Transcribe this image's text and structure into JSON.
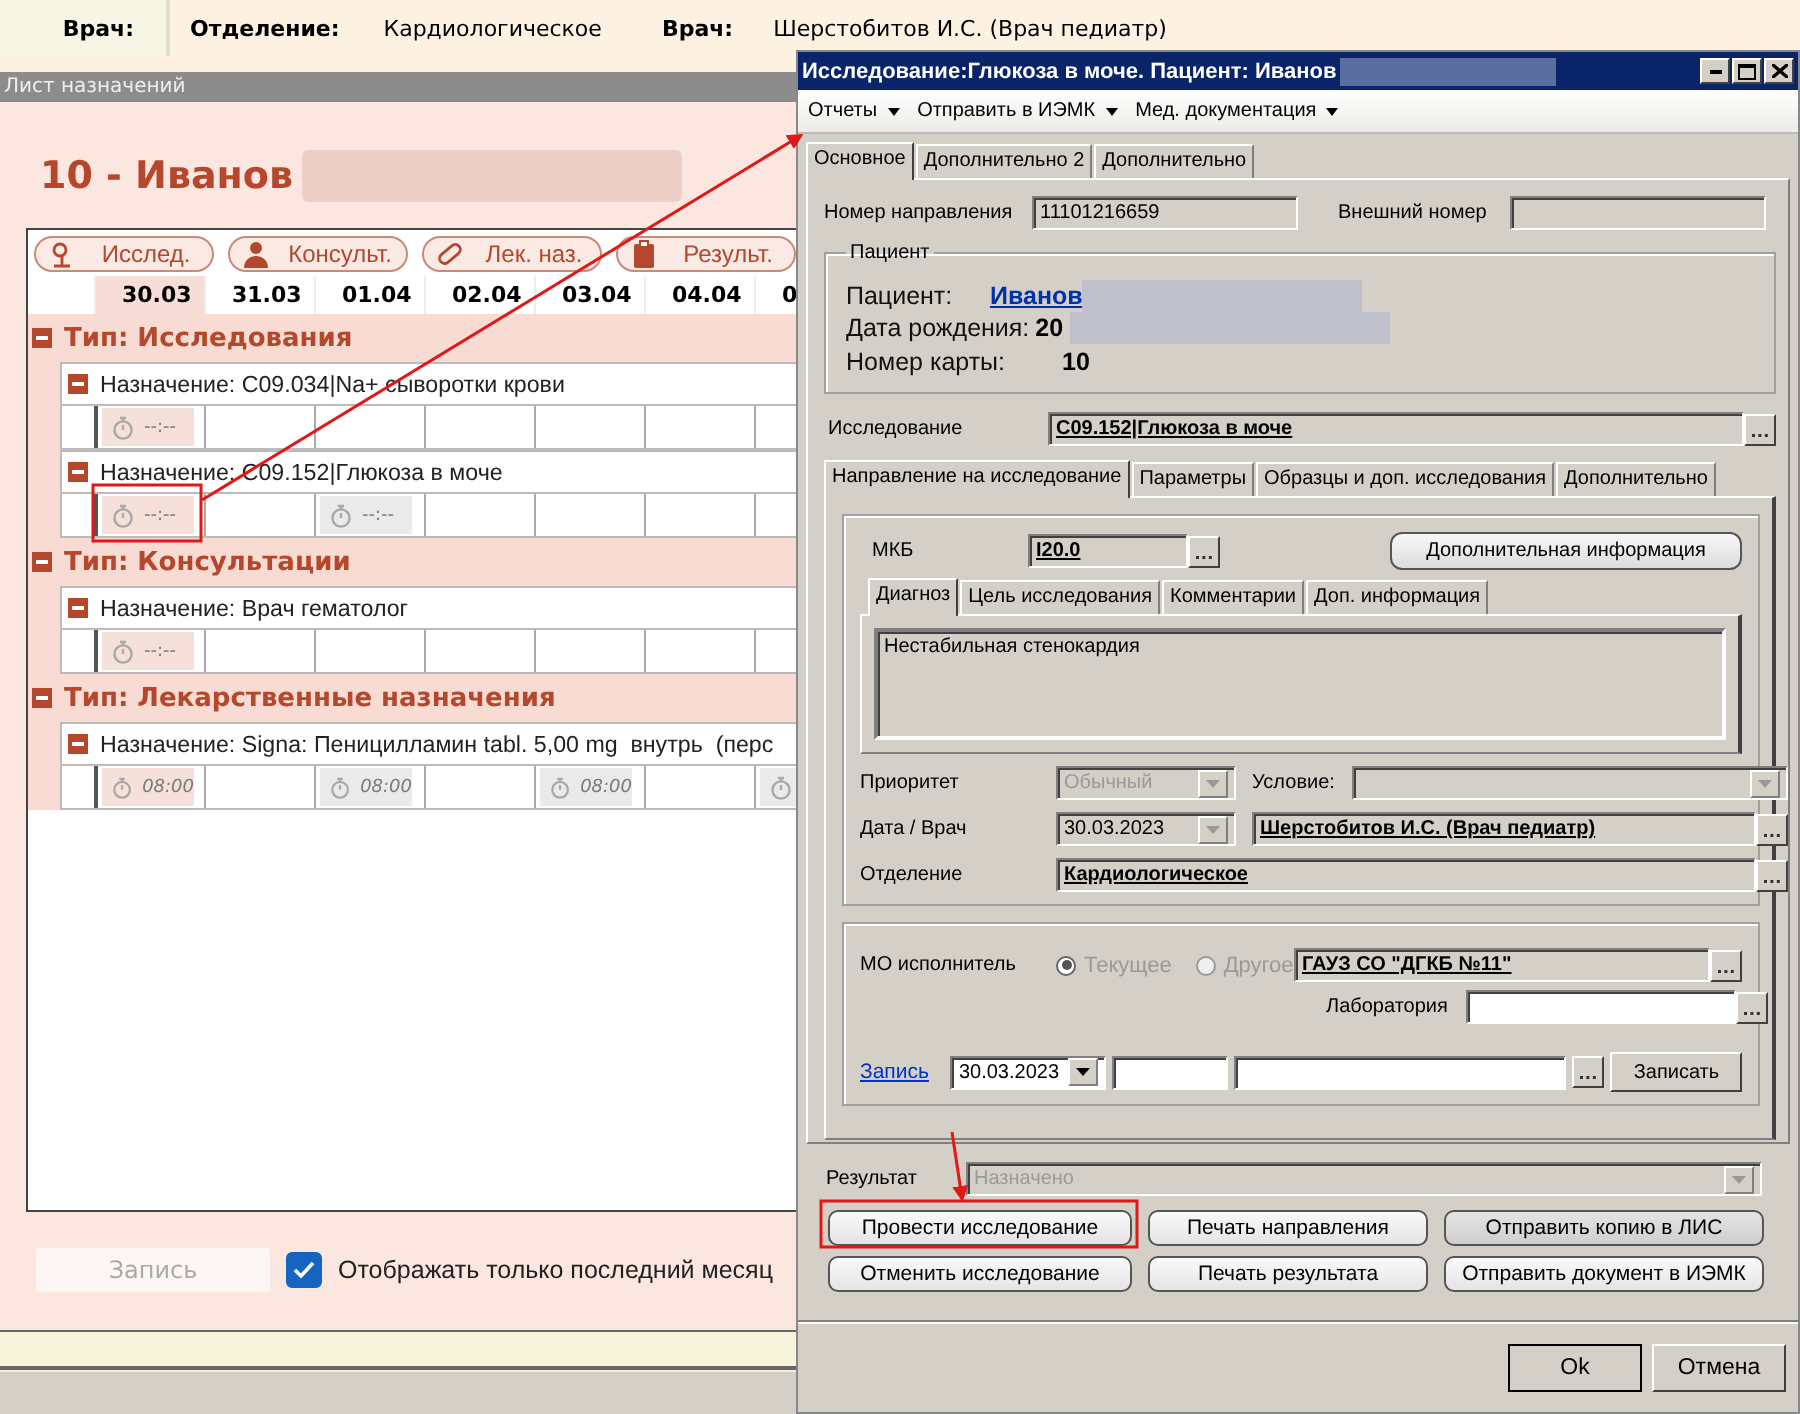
{
  "header": {
    "left_label": "Врач:",
    "department_label": "Отделение:",
    "department": "Кардиологическое",
    "doctor_label": "Врач:",
    "doctor": "Шерстобитов И.С. (Врач педиатр)"
  },
  "schedule": {
    "title": "Лист назначений",
    "patient": "10 - Иванов",
    "toolbar": [
      "Исслед.",
      "Консульт.",
      "Лек. наз.",
      "Результ."
    ],
    "dates": [
      {
        "label": "30.03",
        "selected": true
      },
      {
        "label": "31.03",
        "selected": false
      },
      {
        "label": "01.04",
        "selected": false
      },
      {
        "label": "02.04",
        "selected": false
      },
      {
        "label": "03.04",
        "selected": false
      },
      {
        "label": "04.04",
        "selected": false
      },
      {
        "label": "0",
        "selected": false
      }
    ],
    "groups": [
      {
        "title": "Тип: Исследования",
        "expanded": true,
        "items": [
          {
            "title": "Назначение: C09.034|Na+ сыворотки крови",
            "expanded": true,
            "cells": [
              {
                "kind": "slot",
                "time": "--:--"
              },
              {
                "kind": "blank"
              },
              {
                "kind": "blank"
              },
              {
                "kind": "blank"
              },
              {
                "kind": "blank"
              },
              {
                "kind": "blank"
              },
              {
                "kind": "blank"
              }
            ]
          },
          {
            "title": "Назначение: C09.152|Глюкоза в моче",
            "expanded": true,
            "cells": [
              {
                "kind": "slot",
                "time": "--:--"
              },
              {
                "kind": "blank"
              },
              {
                "kind": "slot",
                "time": "--:--"
              },
              {
                "kind": "blank"
              },
              {
                "kind": "blank"
              },
              {
                "kind": "blank"
              },
              {
                "kind": "blank"
              }
            ]
          }
        ]
      },
      {
        "title": "Тип: Консультации",
        "expanded": true,
        "items": [
          {
            "title": "Назначение: Врач гематолог",
            "expanded": true,
            "cells": [
              {
                "kind": "slot",
                "time": "--:--"
              },
              {
                "kind": "blank"
              },
              {
                "kind": "blank"
              },
              {
                "kind": "blank"
              },
              {
                "kind": "blank"
              },
              {
                "kind": "blank"
              },
              {
                "kind": "blank"
              }
            ]
          }
        ]
      },
      {
        "title": "Тип: Лекарственные назначения",
        "expanded": true,
        "items": [
          {
            "title": "Назначение: Signa: Пеницилламин tabl. 5,00 mg  внутрь  (перс",
            "expanded": true,
            "cells": [
              {
                "kind": "slot",
                "time": "08:00"
              },
              {
                "kind": "blank"
              },
              {
                "kind": "slot",
                "time": "08:00"
              },
              {
                "kind": "blank"
              },
              {
                "kind": "slot",
                "time": "08:00"
              },
              {
                "kind": "blank"
              },
              {
                "kind": "slot"
              }
            ]
          }
        ]
      }
    ],
    "record_button": {
      "label": "Запись",
      "disabled": true
    },
    "filter": {
      "label": "Отображать только последний месяц",
      "checked": true
    }
  },
  "dialog": {
    "title": "Исследование:Глюкоза в моче. Пациент: Иванов",
    "menu": [
      "Отчеты",
      "Отправить в ИЭМК",
      "Мед. документация"
    ],
    "tabs": [
      {
        "label": "Основное",
        "selected": true
      },
      {
        "label": "Дополнительно 2",
        "selected": false
      },
      {
        "label": "Дополнительно",
        "selected": false
      }
    ],
    "referral_number": {
      "label": "Номер направления",
      "value": "11101216659"
    },
    "external_number": {
      "label": "Внешний номер"
    },
    "patient": {
      "legend": "Пациент",
      "name_label": "Пациент:",
      "name": "Иванов",
      "birth_label": "Дата рождения:",
      "birth": "20",
      "card_label": "Номер карты:",
      "card": "10"
    },
    "study": {
      "label": "Исследование",
      "value": "C09.152|Глюкоза в моче"
    },
    "study_tabs": [
      {
        "label": "Направление на исследование",
        "selected": true
      },
      {
        "label": "Параметры",
        "selected": false
      },
      {
        "label": "Образцы и доп. исследования",
        "selected": false
      },
      {
        "label": "Дополнительно",
        "selected": false
      }
    ],
    "icd": {
      "label": "МКБ",
      "value": "I20.0"
    },
    "extra_info_button": "Дополнительная информация",
    "diagnosis_tabs": [
      {
        "label": "Диагноз",
        "selected": true
      },
      {
        "label": "Цель исследования",
        "selected": false
      },
      {
        "label": "Комментарии",
        "selected": false
      },
      {
        "label": "Доп. информация",
        "selected": false
      }
    ],
    "diagnosis_text": "Нестабильная стенокардия",
    "priority": {
      "label": "Приоритет",
      "value": "Обычный",
      "disabled": true
    },
    "condition": {
      "label": "Условие:"
    },
    "date_doctor": {
      "label": "Дата / Врач",
      "date": "30.03.2023",
      "doctor": "Шерстобитов И.С. (Врач педиатр)"
    },
    "department": {
      "label": "Отделение",
      "value": "Кардиологическое"
    },
    "executor": {
      "label": "МО исполнитель",
      "disabled": true,
      "options": [
        {
          "label": "Текущее",
          "selected": true
        },
        {
          "label": "Другое",
          "selected": false
        }
      ],
      "value": "ГАУЗ СО \"ДГКБ №11\""
    },
    "laboratory": {
      "label": "Лаборатория"
    },
    "booking": {
      "link": "Запись",
      "date": "30.03.2023",
      "button": "Записать"
    },
    "result": {
      "label": "Результат",
      "value": "Назначено",
      "disabled": true
    },
    "actions": [
      "Провести исследование",
      "Печать направления",
      "Отправить копию в ЛИС",
      "Отменить исследование",
      "Печать результата",
      "Отправить документ в ИЭМК"
    ],
    "ok": "Ok",
    "cancel": "Отмена"
  }
}
